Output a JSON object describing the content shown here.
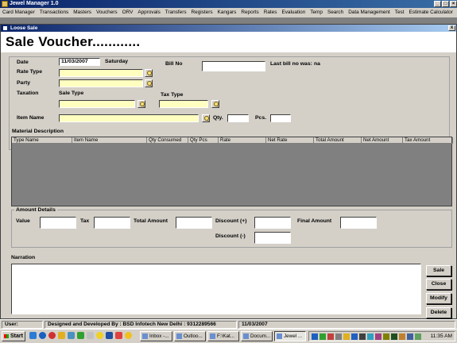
{
  "app": {
    "title": "Jewel Manager 1.0"
  },
  "menu": [
    "Card Manager",
    "Transactions",
    "Masters",
    "Vouchers",
    "ORV",
    "Approvals",
    "Transfers",
    "Registers",
    "Kangars",
    "Reports",
    "Rates",
    "Evaluation",
    "Temp",
    "Search",
    "Data Management",
    "Test",
    "Estimate Calculator"
  ],
  "child_window": {
    "title": "Loose Sale",
    "close_glyph": "x"
  },
  "page_title": "Sale Voucher............",
  "form": {
    "date_label": "Date",
    "date_value": "11/03/2007",
    "day_value": "Saturday",
    "bill_no_label": "Bill No",
    "bill_no_value": "",
    "last_bill_label": "Last bill no was:",
    "last_bill_value": "na",
    "rate_type_label": "Rate Type",
    "party_label": "Party",
    "taxation_label": "Taxation",
    "sale_type_label": "Sale Type",
    "tax_type_label": "Tax Type",
    "item_name_label": "Item Name",
    "qty_label": "Qty.",
    "pcs_label": "Pcs."
  },
  "material": {
    "label": "Material Description",
    "columns": [
      "Type Name",
      "Item Name",
      "Qty Consumed",
      "Qty Pcs",
      "Rate",
      "Net Rate",
      "Total Amount",
      "Net Amount",
      "Tax Amount"
    ]
  },
  "amount": {
    "legend": "Amount Details",
    "value_label": "Value",
    "tax_label": "Tax",
    "total_label": "Total Amount",
    "discount_plus_label": "Discount (+)",
    "discount_minus_label": "Discount (-)",
    "final_label": "Final Amount"
  },
  "narration_label": "Narration",
  "buttons": {
    "sale": "Sale",
    "close": "Close",
    "modify": "Modify",
    "delete": "Delete"
  },
  "status": {
    "user": "User:",
    "credit": "Designed and Developed By : BSD Infotech New Delhi : 9312289566",
    "date": "11/03/2007"
  },
  "taskbar": {
    "start": "Start",
    "tasks": [
      "Inbox -...",
      "Outloo...",
      "F:\\Kat...",
      "Docum...",
      "Jewel ..."
    ],
    "clock": "11:35 AM"
  },
  "colors": {
    "titlebar": "#0a246a",
    "input_highlight": "#ffffc0",
    "grid_bg": "#808080"
  }
}
